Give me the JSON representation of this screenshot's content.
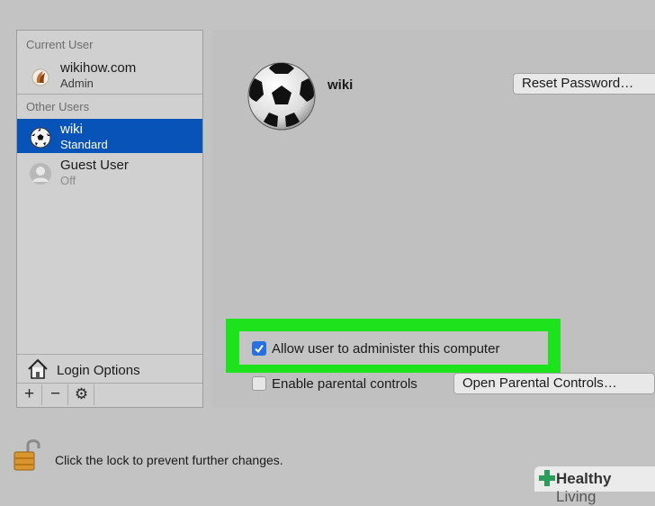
{
  "sidebar": {
    "current_user_heading": "Current User",
    "current_user": {
      "name": "wikihow.com",
      "role": "Admin"
    },
    "other_users_heading": "Other Users",
    "other_users": [
      {
        "name": "wiki",
        "role": "Standard",
        "selected": true
      },
      {
        "name": "Guest User",
        "role": "Off",
        "selected": false
      }
    ],
    "login_options_label": "Login Options",
    "add_button": "+",
    "remove_button": "−",
    "gear_button": "⚙"
  },
  "panel": {
    "user_name": "wiki",
    "reset_password_button": "Reset Password…",
    "allow_admin_label": "Allow user to administer this computer",
    "allow_admin_checked": true,
    "parental_controls_label": "Enable parental controls",
    "parental_controls_checked": false,
    "open_parental_button": "Open Parental Controls…"
  },
  "footer": {
    "lock_text": "Click the lock to prevent further changes."
  },
  "watermark": {
    "bold": "Healthy",
    "light": "Living"
  },
  "colors": {
    "selection": "#0853b8",
    "highlight_box": "#1de31d",
    "checkbox_checked": "#2a6fe0"
  }
}
